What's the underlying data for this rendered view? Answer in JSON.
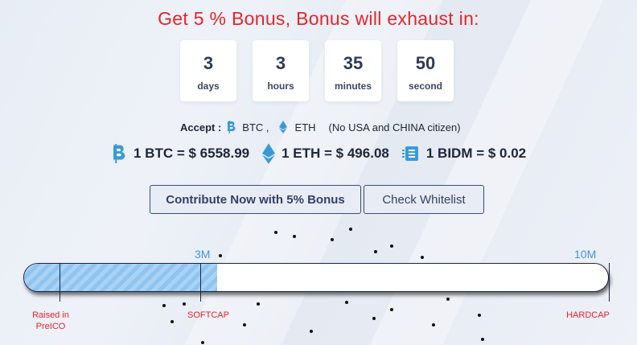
{
  "bonus_banner": "Get 5 % Bonus, Bonus will exhaust in:",
  "countdown": [
    {
      "value": "3",
      "unit": "days"
    },
    {
      "value": "3",
      "unit": "hours"
    },
    {
      "value": "35",
      "unit": "minutes"
    },
    {
      "value": "50",
      "unit": "second"
    }
  ],
  "accept": {
    "label": "Accept :",
    "btc": "BTC ,",
    "eth": "ETH",
    "note": "(No USA and CHINA citizen)"
  },
  "rates": {
    "btc": "1 BTC = $ 6558.99",
    "eth": "1 ETH = $ 496.08",
    "bidm": "1 BIDM = $ 0.02"
  },
  "buttons": {
    "contribute": "Contribute Now with 5% Bonus",
    "whitelist": "Check Whitelist"
  },
  "progress": {
    "fill_fraction": 0.33,
    "softcap_top": "3M",
    "hardcap_top": "10M",
    "preico_label": "Raised in PreICO",
    "softcap_label": "SOFTCAP",
    "hardcap_label": "HARDCAP"
  },
  "colors": {
    "accent_red": "#e5242b",
    "btc_blue": "#3a9ad9",
    "button_border": "#3a4a7c"
  }
}
